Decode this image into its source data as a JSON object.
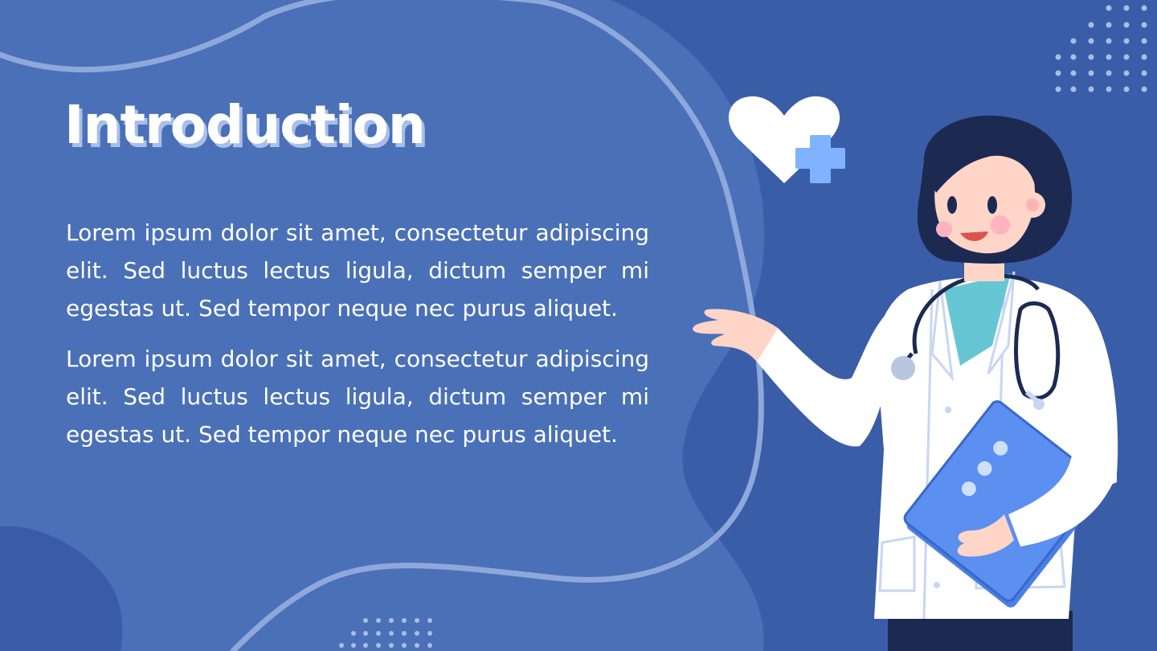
{
  "slide": {
    "title": "Introduction",
    "paragraphs": [
      "Lorem ipsum dolor sit amet, consectetur adipiscing elit. Sed luctus lectus ligula, dictum semper mi egestas ut. Sed tempor neque nec purus aliquet.",
      "Lorem ipsum dolor sit amet, consectetur adipiscing elit. Sed luctus lectus ligula, dictum semper mi egestas ut. Sed tempor neque nec purus aliquet."
    ]
  },
  "colors": {
    "background": "#3a5da8",
    "blob": "#4a70b7",
    "title_shadow": "#a9bfe8",
    "text": "#ffffff",
    "accent_light_blue": "#7fb2ff"
  },
  "decorations": {
    "heart_icon": "heart-icon",
    "plus_icon": "plus-icon",
    "illustration": "doctor-illustration"
  }
}
